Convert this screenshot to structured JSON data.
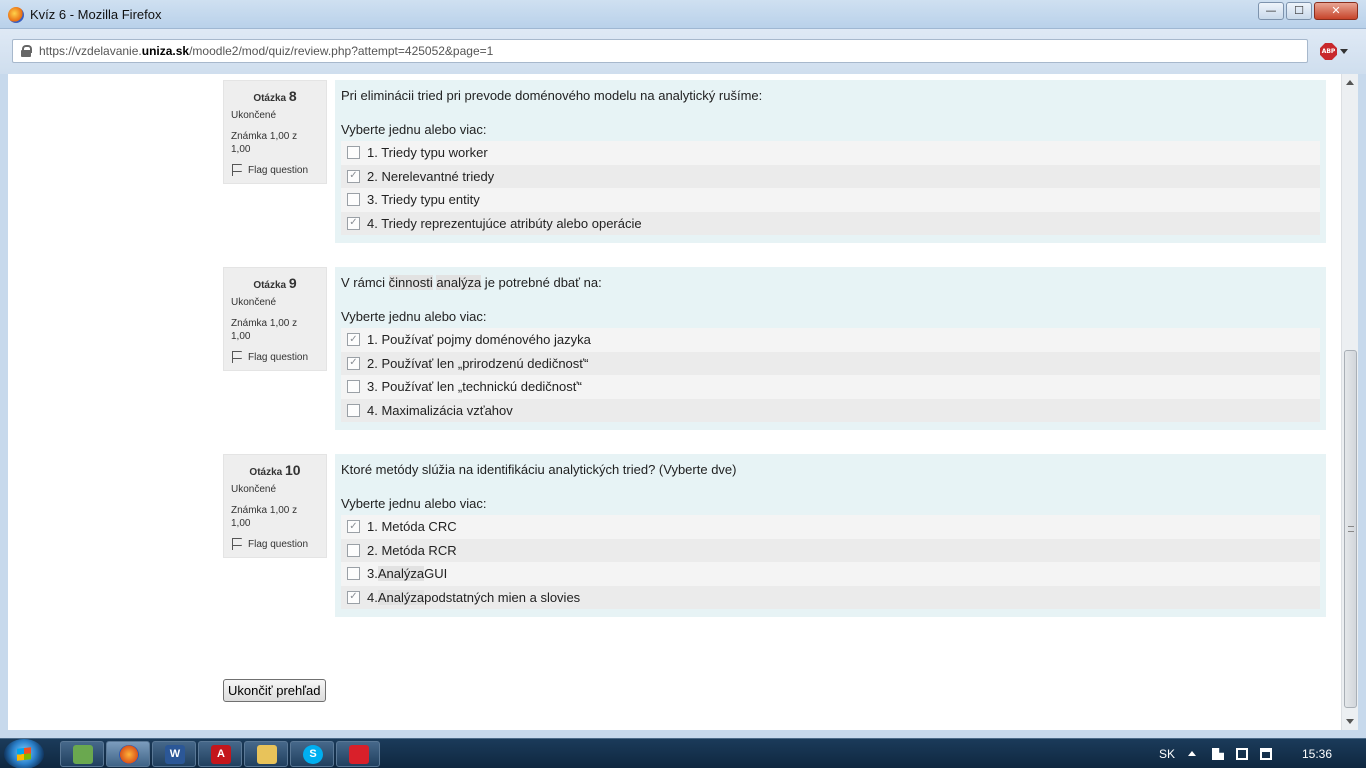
{
  "window": {
    "title": "Kvíz 6 - Mozilla Firefox",
    "min": "—",
    "max": "☐",
    "close": "✕"
  },
  "address": {
    "prefix": "https://vzdelavanie.",
    "domain": "uniza.sk",
    "path": "/moodle2/mod/quiz/review.php?attempt=425052&page=1",
    "abp": "ABP"
  },
  "questions": [
    {
      "label": "Otázka",
      "number": "8",
      "state": "Ukončené",
      "grade": "Známka 1,00 z 1,00",
      "flag": "Flag question",
      "text": "Pri eliminácii tried pri prevode doménového modelu na analytický rušíme:",
      "prompt": "Vyberte jednu alebo viac:",
      "options": [
        {
          "text": "1. Triedy typu worker",
          "checked": false
        },
        {
          "text": "2. Nerelevantné triedy",
          "checked": true
        },
        {
          "text": "3. Triedy typu entity",
          "checked": false
        },
        {
          "text": "4. Triedy reprezentujúce atribúty alebo operácie",
          "checked": true
        }
      ]
    },
    {
      "label": "Otázka",
      "number": "9",
      "state": "Ukončené",
      "grade": "Známka 1,00 z 1,00",
      "flag": "Flag question",
      "text_parts": [
        "V rámci ",
        "činnosti",
        " ",
        "analýza",
        " je potrebné dbať na:"
      ],
      "prompt": "Vyberte jednu alebo viac:",
      "options": [
        {
          "text": "1. Používať pojmy doménového jazyka",
          "checked": true
        },
        {
          "text": "2. Používať len „prirodzenú dedičnosť“",
          "checked": true
        },
        {
          "text": "3. Používať len „technickú dedičnosť“",
          "checked": false
        },
        {
          "text": "4. Maximalizácia vzťahov",
          "checked": false
        }
      ]
    },
    {
      "label": "Otázka",
      "number": "10",
      "state": "Ukončené",
      "grade": "Známka 1,00 z 1,00",
      "flag": "Flag question",
      "text": "Ktoré metódy slúžia na identifikáciu analytických tried? (Vyberte dve)",
      "prompt": "Vyberte jednu alebo viac:",
      "options": [
        {
          "text": "1. Metóda CRC",
          "checked": true
        },
        {
          "text": "2. Metóda RCR",
          "checked": false
        },
        {
          "pre": "3. ",
          "hl": "Analýza",
          "post": " GUI",
          "checked": false
        },
        {
          "pre": "4. ",
          "hl": "Analýza",
          "post": " podstatných mien a slovies",
          "checked": true
        }
      ]
    }
  ],
  "finish_button": "Ukončiť prehľad",
  "taskbar": {
    "lang": "SK",
    "time": "15:36",
    "apps": [
      "W",
      "A",
      "S"
    ]
  },
  "checkmark": "✓"
}
